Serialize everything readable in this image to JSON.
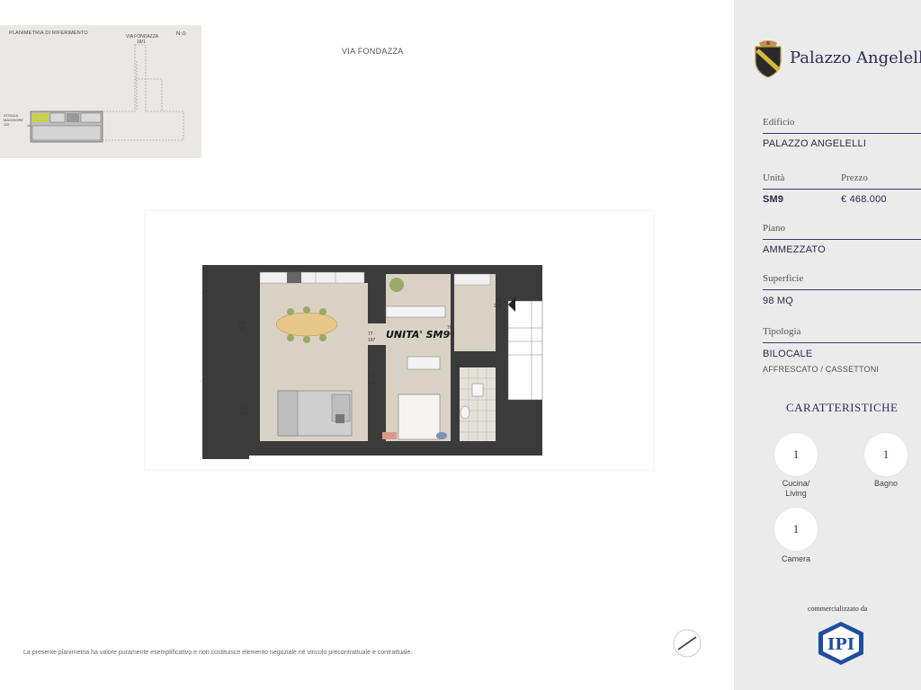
{
  "keyplan": {
    "title": "PLANIMETRIA DI RIFERIMENTO",
    "street_label": "VIA FONDAZZA",
    "street_number": "18/1",
    "north_label": "N",
    "left_street": "STRADA MAGGIORE",
    "left_number": "110"
  },
  "plan": {
    "street_label": "VIA FONDAZZA",
    "unit_label": "UNITA' SM9",
    "dims": [
      {
        "t1": "100",
        "t2": "161"
      },
      {
        "t1": "100",
        "t2": "161"
      },
      {
        "t1": "77",
        "t2": "197"
      },
      {
        "t1": "77",
        "t2": "200"
      },
      {
        "t1": "70",
        "t2": "201"
      },
      {
        "t1": "90",
        "t2": "216"
      }
    ]
  },
  "disclaimer": "La presente planimetria ha valore puramente esemplificativo e non costituisce elemento negoziale né vincolo precontrattuale e contrattuale.",
  "sidebar": {
    "brand": "Palazzo Angelelli",
    "edificio_label": "Edificio",
    "edificio_value": "PALAZZO ANGELELLI",
    "unita_label": "Unità",
    "unita_value": "SM9",
    "prezzo_label": "Prezzo",
    "prezzo_value": "€ 468.000",
    "piano_label": "Piano",
    "piano_value": "AMMEZZATO",
    "superficie_label": "Superficie",
    "superficie_value": "98 MQ",
    "tipologia_label": "Tipologia",
    "tipologia_value": "BILOCALE",
    "tipologia_note": "AFFRESCATO / CASSETTONI",
    "caratteristiche_title": "CARATTERISTICHE",
    "features": [
      {
        "count": "1",
        "label_line1": "Cucina/",
        "label_line2": "Living"
      },
      {
        "count": "1",
        "label_line1": "Bagno",
        "label_line2": ""
      },
      {
        "count": "1",
        "label_line1": "Camera",
        "label_line2": ""
      }
    ],
    "commercializzato": "commercializzato da",
    "agency_logo_text": "IPI"
  },
  "colors": {
    "navy": "#2b2b5a",
    "sidebar_bg": "#ecebeb",
    "wall": "#3b3b3b",
    "floor": "#d9d2c4",
    "table": "#e8c889",
    "chair": "#9aaa66"
  }
}
